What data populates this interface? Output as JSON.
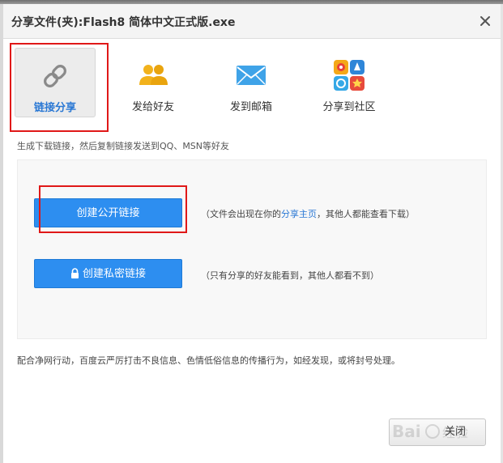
{
  "dialog": {
    "title": "分享文件(夹):Flash8 简体中文正式版.exe"
  },
  "tabs": [
    {
      "label": "链接分享",
      "icon": "link-icon",
      "active": true
    },
    {
      "label": "发给好友",
      "icon": "friends-icon",
      "active": false
    },
    {
      "label": "发到邮箱",
      "icon": "mail-icon",
      "active": false
    },
    {
      "label": "分享到社区",
      "icon": "community-icon",
      "active": false
    }
  ],
  "hint": "生成下载链接，然后复制链接发送到QQ、MSN等好友",
  "public_link": {
    "button_label": "创建公开链接",
    "desc_before": "（文件会出现在你的",
    "desc_link": "分享主页",
    "desc_after": "，其他人都能查看下载）"
  },
  "private_link": {
    "button_label": "创建私密链接",
    "desc": "（只有分享的好友能看到，其他人都看不到）"
  },
  "notice": "配合净网行动，百度云严厉打击不良信息、色情低俗信息的传播行为，如经发现，或将封号处理。",
  "close_button": "关闭",
  "colors": {
    "accent": "#2d8ef0",
    "highlight": "#e01818",
    "link": "#2a78d4"
  }
}
